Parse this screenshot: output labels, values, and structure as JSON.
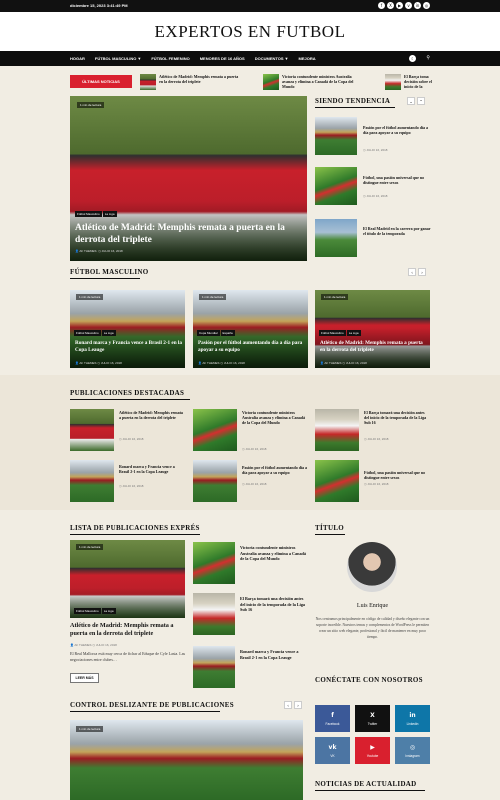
{
  "top_bar": {
    "date": "diciembre 15, 2023 3:41:49 PM",
    "social": [
      "f",
      "X",
      "▶",
      "v",
      "in",
      "◎"
    ]
  },
  "site": {
    "title": "EXPERTOS EN FUTBOL"
  },
  "nav": {
    "items": [
      {
        "label": "HOGAR",
        "dropdown": false
      },
      {
        "label": "FÚTBOL MASCULINO",
        "dropdown": true
      },
      {
        "label": "FÚTBOL FEMENINO",
        "dropdown": false
      },
      {
        "label": "MENORES DE 16 AÑOS",
        "dropdown": false
      },
      {
        "label": "DOCUMENTOS",
        "dropdown": true
      },
      {
        "label": "MEJORA",
        "dropdown": false
      }
    ],
    "toggle_icon": "☾",
    "search_icon": "⚲"
  },
  "ticker": {
    "label": "ÚLTIMAS NOTICIAS",
    "items": [
      "Atlético de Madrid: Memphis remata a puerta en la derrota del triplete",
      "Victoria contundente ministros Australia avanza y elimina a Canadá de la Copa del Mundo",
      "El Barça toma decisión sobre el inicio de la temporada de la Liga Sub 16"
    ]
  },
  "hero": {
    "read_time": "1 min de lectura",
    "tags": [
      "Fútbol Masculino",
      "La Liga"
    ],
    "title": "Atlético de Madrid: Memphis remata a puerta en la derrota del triplete",
    "author": "AF THEMES",
    "date": "JULIO 16, 2018"
  },
  "trending": {
    "title": "SIENDO TENDENCIA",
    "items": [
      {
        "title": "Pasión por el fútbol aumentando día a día para apoyar a su equipo",
        "date": "JULIO 16, 2018"
      },
      {
        "title": "Fútbol, una pasión universal que no distingue entre sexos",
        "date": "JULIO 16, 2018"
      },
      {
        "title": "El Real Madrid en la carrera por ganar el título de la temporada",
        "date": "JULIO 16, 2018"
      }
    ]
  },
  "mens": {
    "title": "FÚTBOL MASCULINO",
    "cards": [
      {
        "read_time": "1 min de lectura",
        "tags": [
          "Fútbol Masculino",
          "La Liga"
        ],
        "title": "Ronard marca y Francia vence a Brasil 2-1 en la Copa Leauge",
        "author": "AF THEMES",
        "date": "JULIO 16, 2018"
      },
      {
        "read_time": "1 min de lectura",
        "tags": [
          "Copa Mundial",
          "España"
        ],
        "title": "Pasión por el fútbol aumentando día a día para apoyar a su equipo",
        "author": "AF THEMES",
        "date": "JULIO 16, 2018"
      },
      {
        "read_time": "1 min de lectura",
        "tags": [
          "Fútbol Masculino",
          "La Liga"
        ],
        "title": "Atlético de Madrid: Memphis remata a puerta en la derrota del triplete",
        "author": "AF THEMES",
        "date": "JULIO 16, 2018"
      }
    ]
  },
  "featured": {
    "title": "PUBLICACIONES DESTACADAS",
    "items": [
      {
        "title": "Atlético de Madrid: Memphis remata a puerta en la derrota del triplete",
        "date": "JULIO 16, 2018"
      },
      {
        "title": "Victoria contundente ministros Australia avanza y elimina a Canadá de la Copa del Mundo",
        "date": "JULIO 16, 2018"
      },
      {
        "title": "El Barça tomará una decisión antes del inicio de la temporada de la Liga Sub 16",
        "date": "JULIO 16, 2018"
      },
      {
        "title": "Ronard marca y Francia vence a Brasil 2-1 en la Copa Leauge",
        "date": "JULIO 16, 2018"
      },
      {
        "title": "Pasión por el fútbol aumentando día a día para apoyar a su equipo",
        "date": "JULIO 16, 2018"
      },
      {
        "title": "Fútbol, una pasión universal que no distingue entre sexos",
        "date": "JULIO 16, 2018"
      }
    ]
  },
  "express": {
    "title": "LISTA DE PUBLICACIONES EXPRÉS",
    "main": {
      "read_time": "1 min de lectura",
      "tags": [
        "Fútbol Masculino",
        "La Liga"
      ],
      "title": "Atlético de Madrid: Memphis remata a puerta en la derrota del triplete",
      "author": "AF THEMES",
      "date": "JULIO 16, 2018",
      "excerpt": "El Real Mallorca está muy cerca de fichar al Eduque de Cyle Lasia. Las negociaciones entre clubes…",
      "read_more": "LEER MÁS"
    },
    "items": [
      {
        "title": "Victoria contundente ministros Australia avanza y elimina a Canadá de la Copa del Mundo"
      },
      {
        "title": "El Barça tomará una decisión antes del inicio de la temporada de la Liga Sub 16"
      },
      {
        "title": "Ronard marca y Francia vence a Brasil 2-1 en la Copa Leauge"
      }
    ]
  },
  "author_widget": {
    "title": "TÍTULO",
    "name": "Luis Enrique",
    "bio": "Nos centramos principalmente en código de calidad y diseño elegante con un soporte increíble. Nuestros temas y complementos de WordPress le permiten crear un sitio web elegante, profesional y fácil de mantener en muy poco tiempo."
  },
  "connect": {
    "title": "CONÉCTATE CON NOSOTROS",
    "tiles": [
      {
        "label": "Facebook",
        "icon": "f",
        "color": "#3b5998"
      },
      {
        "label": "Twitter",
        "icon": "X",
        "color": "#111111"
      },
      {
        "label": "Linkedin",
        "icon": "in",
        "color": "#0e76a8"
      },
      {
        "label": "VK",
        "icon": "vk",
        "color": "#4c75a3"
      },
      {
        "label": "Youtube",
        "icon": "▶",
        "color": "#d9202e"
      },
      {
        "label": "Instagram",
        "icon": "◎",
        "color": "#4e7fa8"
      }
    ]
  },
  "slider": {
    "title": "CONTROL DESLIZANTE DE PUBLICACIONES",
    "read_time": "1 min de lectura"
  },
  "news_widget": {
    "title": "NOTICIAS DE ACTUALIDAD"
  }
}
